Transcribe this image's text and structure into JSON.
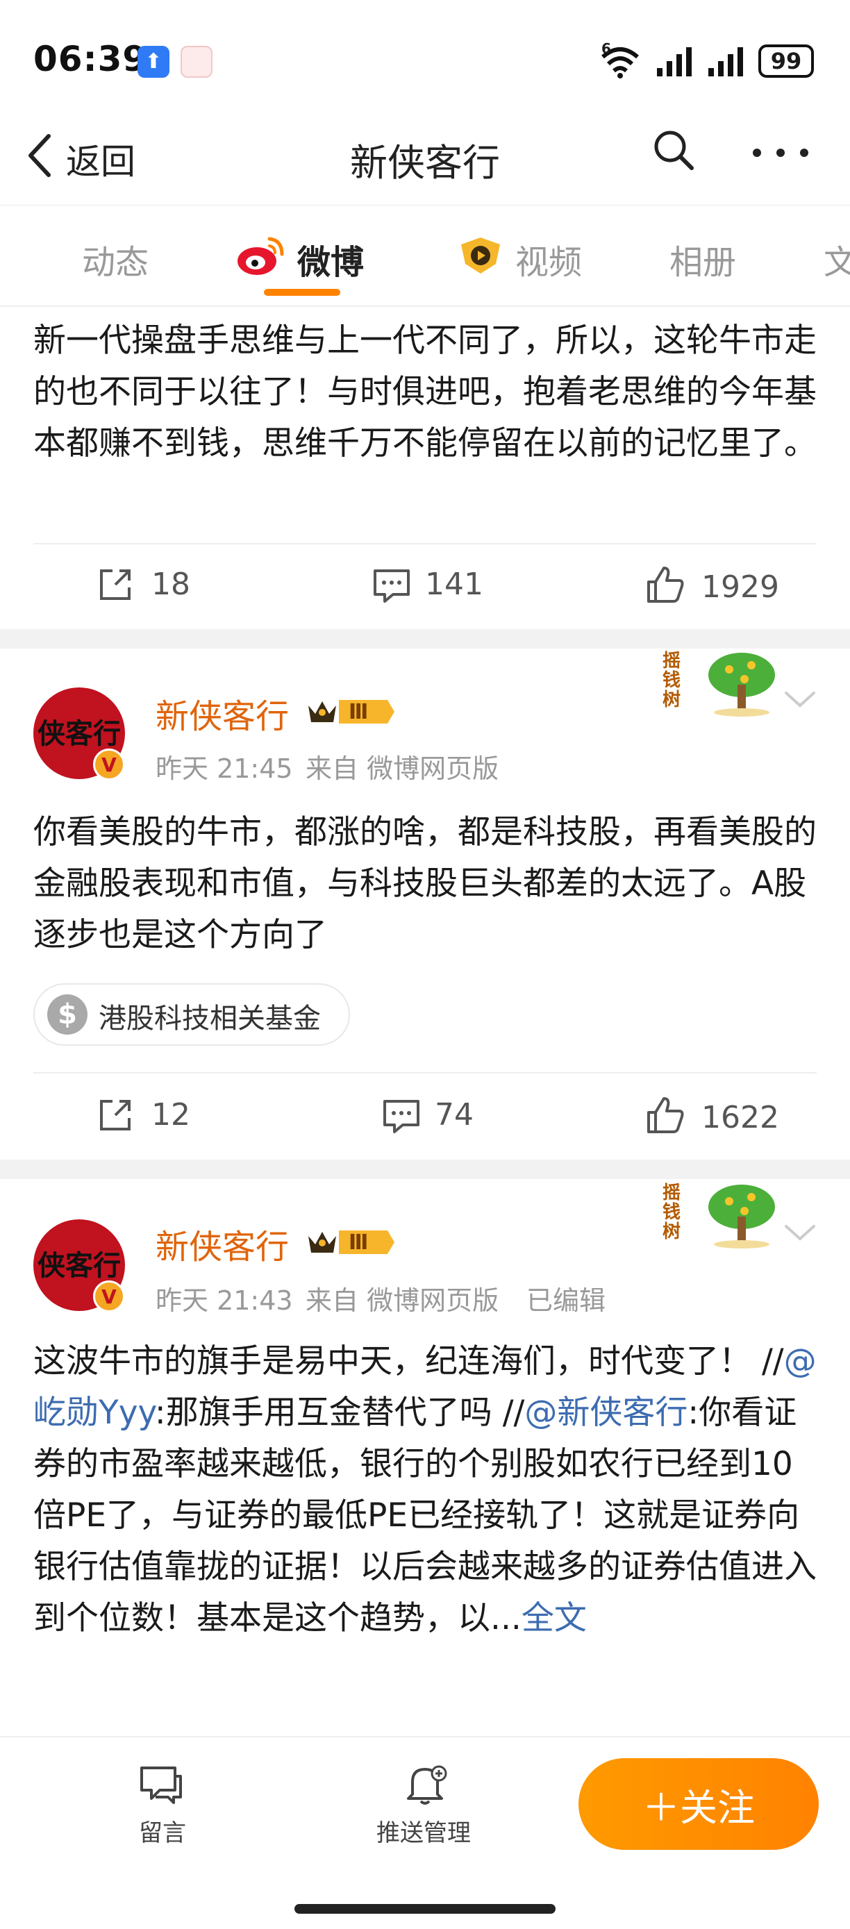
{
  "status_bar": {
    "time": "06:39",
    "battery": "99",
    "signal_label": "6"
  },
  "nav": {
    "back_label": "返回",
    "title": "新侠客行"
  },
  "tabs": [
    {
      "label": "动态"
    },
    {
      "label": "微博"
    },
    {
      "label": "视频"
    },
    {
      "label": "相册"
    },
    {
      "label": "文"
    }
  ],
  "posts": [
    {
      "text": "新一代操盘手思维与上一代不同了，所以，这轮牛市走的也不同于以往了！与时俱进吧，抱着老思维的今年基本都赚不到钱，思维千万不能停留在以前的记忆里了。",
      "reposts": "18",
      "comments": "141",
      "likes": "1929"
    },
    {
      "author": "新侠客行",
      "level": "Ⅲ",
      "time": "昨天 21:45",
      "source": "来自 微博网页版",
      "decor_label": "摇钱树",
      "text": "你看美股的牛市，都涨的啥，都是科技股，再看美股的金融股表现和市值，与科技股巨头都差的太远了。A股逐步也是这个方向了",
      "tag": "港股科技相关基金",
      "reposts": "12",
      "comments": "74",
      "likes": "1622"
    },
    {
      "author": "新侠客行",
      "level": "Ⅲ",
      "time": "昨天 21:43",
      "source": "来自 微博网页版",
      "edited": "已编辑",
      "decor_label": "摇钱树",
      "text_a": "这波牛市的旗手是易中天，纪连海们，时代变了！ //",
      "mention_1": "@屹勋Yyy",
      "text_b": ":那旗手用互金替代了吗 //",
      "mention_2": "@新侠客行",
      "text_c": ":你看证券的市盈率越来越低，银行的个别股如农行已经到10倍PE了，与证券的最低PE已经接轨了！这就是证券向银行估值靠拢的证据！以后会越来越多的证券估值进入到个位数！基本是这个趋势，以...",
      "more": "全文"
    }
  ],
  "bottom_bar": {
    "message_label": "留言",
    "push_label": "推送管理",
    "follow_label": "＋关注"
  },
  "colors": {
    "accent": "#ff8200",
    "author": "#e0640b",
    "link": "#3d6cb0"
  }
}
